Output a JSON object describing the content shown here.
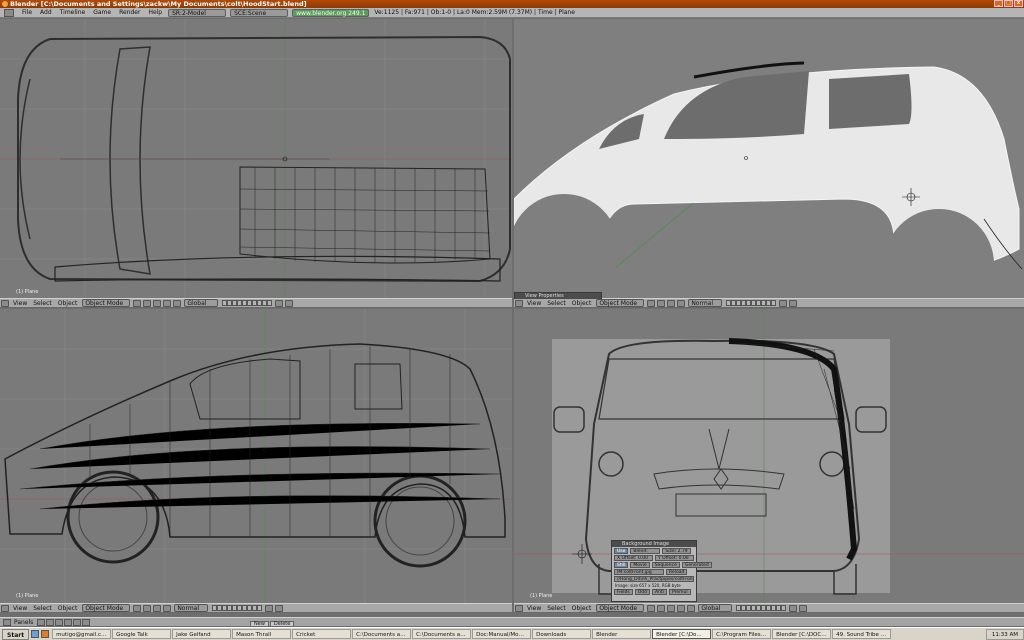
{
  "window": {
    "title": "Blender [C:\\Documents and Settings\\zackw\\My Documents\\colt\\HoodStart.blend]"
  },
  "menubar": {
    "items": [
      "File",
      "Add",
      "Timeline",
      "Game",
      "Render",
      "Help"
    ],
    "screen": "SR:2-Model",
    "scene": "SCE:Scene",
    "url": "www.blender.org 249.1",
    "stats": "Ve:1125 | Fa:971 | Ob:1-0 | La:0  Mem:2.59M (7.37M) | Time | Plane"
  },
  "viewports": {
    "top_left": {
      "label": "(1) Plane",
      "view_mode": "Object Mode",
      "orientation": "Global"
    },
    "top_right": {
      "label": "",
      "view_mode": "Object Mode",
      "shading": "Normal",
      "panel_title": "View Properties"
    },
    "bottom_left": {
      "label": "(1) Plane",
      "view_mode": "Object Mode",
      "shading": "Normal"
    },
    "bottom_right": {
      "label": "(1) Plane",
      "view_mode": "Object Mode",
      "orientation": "Global"
    }
  },
  "viewport_menu": {
    "view": "View",
    "select": "Select",
    "object": "Object"
  },
  "bg_panel": {
    "title": "Background Image",
    "use": "Use",
    "blend": "Blend: 0.50",
    "size": "Size: 2.79",
    "xoff": "X Offset: 0.00",
    "yoff": "Y Offset: 0.00",
    "tabs": [
      "Still",
      "Movie",
      "Sequence",
      "Generated"
    ],
    "image": "IM:coltFront.jpg",
    "reload": "Reload",
    "path": "//Hong_Ddinh_Practpipes/coltFront.jpg",
    "info": "Image: size 657 x 520, RGB byte",
    "btn_fields": "Fields",
    "btn_odd": "Odd",
    "btn_anti": "Anti",
    "btn_premul": "Premul"
  },
  "panels_bar": {
    "label": "Panels"
  },
  "props_tabs": [
    "New",
    "Delete"
  ],
  "taskbar": {
    "start": "Start",
    "tasks": [
      {
        "label": "mutigo@gmail.com",
        "active": false
      },
      {
        "label": "Google Talk",
        "active": false
      },
      {
        "label": "Jake Gelfand",
        "active": false
      },
      {
        "label": "Mason Thrall",
        "active": false
      },
      {
        "label": "Cricket",
        "active": false
      },
      {
        "label": "C:\\Documents and ...",
        "active": false
      },
      {
        "label": "C:\\Documents and ...",
        "active": false
      },
      {
        "label": "Doc:Manual/Model...",
        "active": false
      },
      {
        "label": "Downloads",
        "active": false
      },
      {
        "label": "Blender",
        "active": false
      },
      {
        "label": "Blender [C:\\Do...",
        "active": true
      },
      {
        "label": "C:\\Program Files\\Bl...",
        "active": false
      },
      {
        "label": "Blender [C:\\DOCU...",
        "active": false
      },
      {
        "label": "49. Sound Tribe Se...",
        "active": false
      }
    ],
    "clock": "11:33 AM"
  },
  "colors": {
    "title_bar": "#b34a07",
    "viewport_bg": "#7a7a7a",
    "header_bg": "#a8a8a8"
  }
}
